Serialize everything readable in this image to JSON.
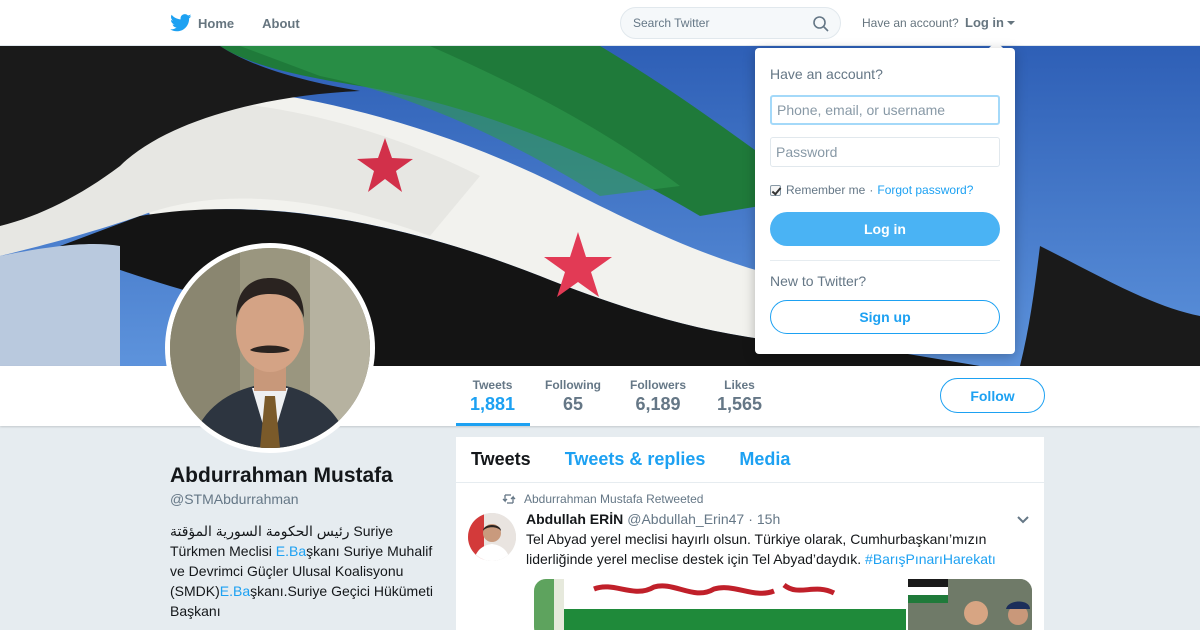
{
  "nav": {
    "home_label": "Home",
    "about_label": "About",
    "search_placeholder": "Search Twitter",
    "account_question": "Have an account?",
    "login_label": "Log in"
  },
  "profile": {
    "name": "Abdurrahman Mustafa",
    "handle": "@STMAbdurrahman",
    "bio": {
      "part1": "رئيس الحكومة السورية المؤقتة Suriye Türkmen Meclisi ",
      "link1": "E.Ba",
      "part2": "şkanı Suriye Muhalif ve Devrimci Güçler Ulusal Koalisyonu (SMDK)",
      "link2": "E.Ba",
      "part3": "şkanı.Suriye Geçici Hükümeti Başkanı"
    }
  },
  "stats": [
    {
      "label": "Tweets",
      "value": "1,881"
    },
    {
      "label": "Following",
      "value": "65"
    },
    {
      "label": "Followers",
      "value": "6,189"
    },
    {
      "label": "Likes",
      "value": "1,565"
    }
  ],
  "follow_label": "Follow",
  "timeline": {
    "tabs": [
      "Tweets",
      "Tweets & replies",
      "Media"
    ],
    "retweet_context": "Abdurrahman Mustafa Retweeted",
    "tweet": {
      "name": "Abdullah ERİN",
      "handle": "@Abdullah_Erin47",
      "dot": "·",
      "time": "15h",
      "text": "Tel Abyad yerel meclisi hayırlı olsun. Türkiye olarak, Cumhurbaşkanı’mızın liderliğinde yerel meclise destek için Tel Abyad’daydık. ",
      "hashtag": "#BarışPınarıHarekatı"
    }
  },
  "login_dropdown": {
    "title": "Have an account?",
    "username_placeholder": "Phone, email, or username",
    "password_placeholder": "Password",
    "remember_label": "Remember me",
    "separator": "·",
    "forgot_label": "Forgot password?",
    "remember_checked": true,
    "login_button": "Log in",
    "new_prompt": "New to Twitter?",
    "signup_button": "Sign up"
  },
  "colors": {
    "accent": "#1da1f2",
    "login_button": "#4ab3f4",
    "background": "#e6ecf0"
  },
  "icons": [
    "twitter-bird-icon",
    "home-icon",
    "search-icon",
    "caret-down-icon",
    "retweet-icon",
    "chevron-down-icon"
  ]
}
